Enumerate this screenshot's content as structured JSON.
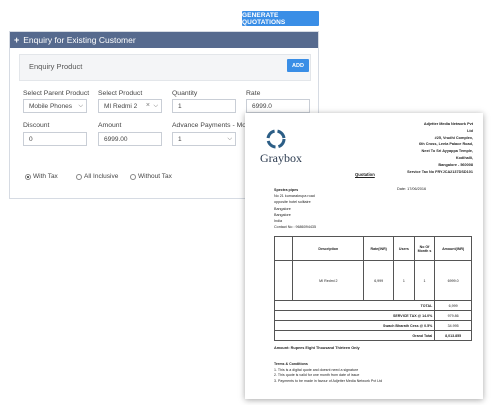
{
  "generate_button": "GENERATE QUOTATIONS",
  "panel": {
    "title": "Enquiry for Existing Customer",
    "product_row_label": "Enquiry Product",
    "add_button": "ADD",
    "fields": {
      "parent_product": {
        "label": "Select Parent Product",
        "value": "Mobile Phones"
      },
      "product": {
        "label": "Select Product",
        "value": "MI Redmi 2"
      },
      "quantity": {
        "label": "Quantity",
        "value": "1"
      },
      "rate": {
        "label": "Rate",
        "value": "6999.0"
      },
      "discount": {
        "label": "Discount",
        "value": "0"
      },
      "amount": {
        "label": "Amount",
        "value": "6999.00"
      },
      "advance": {
        "label": "Advance Payments - Mon",
        "value": "1"
      }
    },
    "tax_options": [
      "With Tax",
      "All Inclusive",
      "Without Tax"
    ],
    "tax_selected": "With Tax"
  },
  "quote": {
    "logo": "Graybox",
    "company_lines": [
      "Adjetter Media Network Pvt",
      "Ltd",
      "#25, Vrudhi Complex,",
      "6th Cross, Leela Palace Road,",
      "Next To Sri Ayyappa Temple,",
      "Kodihalli,",
      "Bangalore - 560008",
      "Service Tax No FRYJCA2137DSD101"
    ],
    "title": "Quotation",
    "date": "Date:  17/06/2016",
    "client_name": "Spectra pipes",
    "client_lines": [
      "No 21 kumarakrupa road",
      "opposite hotel solitaire",
      "Bangalore",
      "Bangalore",
      "India",
      "Contact No : 9686094435"
    ],
    "table": {
      "headers": [
        "",
        "Description",
        "Rate(INR)",
        "Users",
        "No Of Month s",
        "Amount(INR)"
      ],
      "row": [
        "",
        "MI Redmi 2",
        "6,999",
        "1",
        "1",
        "6999.0"
      ],
      "summary": [
        {
          "label": "TOTAL",
          "value": "6,999"
        },
        {
          "label": "SERVICE TAX @ 14.0%",
          "value": "979.86"
        },
        {
          "label": "Swach Bharath Cess @ 0.5%",
          "value": "34.995"
        },
        {
          "label": "Grand Total",
          "value": "8,013.855"
        }
      ]
    },
    "amount_words": "Amount: Rupees Eight Thousand Thirteen Only",
    "terms_title": "Terms & Conditions",
    "terms": [
      "1. This is a digital quote and doesnt need a signature",
      "2. This quote is valid for one month from date of issue",
      "3. Payments to be made in favour of Adjetter Media Network Pvt Ltd"
    ]
  }
}
